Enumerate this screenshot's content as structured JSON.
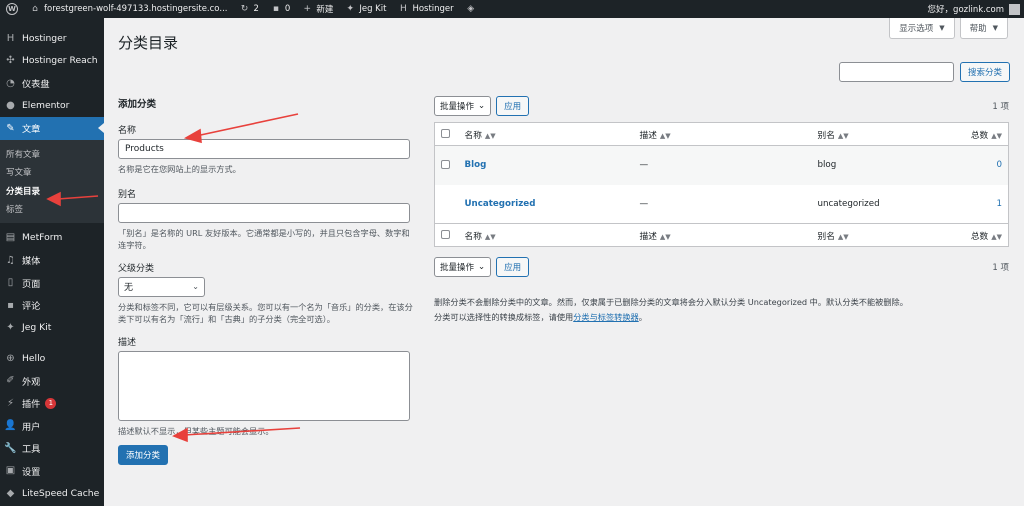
{
  "adminbar": {
    "site_name": "forestgreen-wolf-497133.hostingersite.co...",
    "updates_count": "2",
    "comments_count": "0",
    "new_label": "新建",
    "jegkit_label": "Jeg Kit",
    "hostinger_label": "Hostinger",
    "greeting": "您好，gozlink.com"
  },
  "sidebar": {
    "items": [
      {
        "label": "Hostinger",
        "icon": "hostinger-icon"
      },
      {
        "label": "Hostinger Reach",
        "icon": "reach-icon"
      },
      {
        "label": "仪表盘",
        "icon": "dashboard-icon"
      },
      {
        "label": "Elementor",
        "icon": "elementor-icon"
      },
      {
        "label": "文章",
        "icon": "pin-icon"
      },
      {
        "label": "MetForm",
        "icon": "form-icon"
      },
      {
        "label": "媒体",
        "icon": "media-icon"
      },
      {
        "label": "页面",
        "icon": "page-icon"
      },
      {
        "label": "评论",
        "icon": "comment-icon"
      },
      {
        "label": "Jeg Kit",
        "icon": "jegkit-icon"
      },
      {
        "label": "Hello",
        "icon": "hello-icon"
      },
      {
        "label": "外观",
        "icon": "appearance-icon"
      },
      {
        "label": "插件",
        "icon": "plugin-icon",
        "badge": "1"
      },
      {
        "label": "用户",
        "icon": "user-icon"
      },
      {
        "label": "工具",
        "icon": "tools-icon"
      },
      {
        "label": "设置",
        "icon": "settings-icon"
      },
      {
        "label": "LiteSpeed Cache",
        "icon": "litespeed-icon"
      }
    ],
    "submenu": [
      "所有文章",
      "写文章",
      "分类目录",
      "标签"
    ]
  },
  "screen_options": {
    "display_label": "显示选项",
    "help_label": "帮助"
  },
  "page_title": "分类目录",
  "search": {
    "button_label": "搜索分类"
  },
  "form": {
    "heading": "添加分类",
    "name_label": "名称",
    "name_value": "Products",
    "name_desc": "名称是它在您网站上的显示方式。",
    "slug_label": "别名",
    "slug_desc": "「别名」是名称的 URL 友好版本。它通常都是小写的，并且只包含字母、数字和连字符。",
    "parent_label": "父级分类",
    "parent_value": "无",
    "parent_desc": "分类和标签不同，它可以有层级关系。您可以有一个名为「音乐」的分类，在该分类下可以有名为「流行」和「古典」的子分类（完全可选）。",
    "description_label": "描述",
    "description_desc": "描述默认不显示，但某些主题可能会显示。",
    "submit_label": "添加分类"
  },
  "table": {
    "bulk_label": "批量操作",
    "apply_label": "应用",
    "count_label": "1 项",
    "columns": {
      "name": "名称",
      "description": "描述",
      "slug": "别名",
      "count": "总数"
    },
    "rows": [
      {
        "name": "Blog",
        "description": "—",
        "slug": "blog",
        "count": "0"
      },
      {
        "name": "Uncategorized",
        "description": "—",
        "slug": "uncategorized",
        "count": "1"
      }
    ],
    "note1": "删除分类不会删除分类中的文章。然而，仅隶属于已删除分类的文章将会分入默认分类 Uncategorized 中。默认分类不能被删除。",
    "note2_prefix": "分类可以选择性的转换成标签，请使用",
    "note2_link": "分类与标签转换器",
    "note2_suffix": "。"
  },
  "colors": {
    "accent": "#2271b1",
    "sidebar_bg": "#1d2327",
    "annotation_arrow": "#e8413c"
  }
}
